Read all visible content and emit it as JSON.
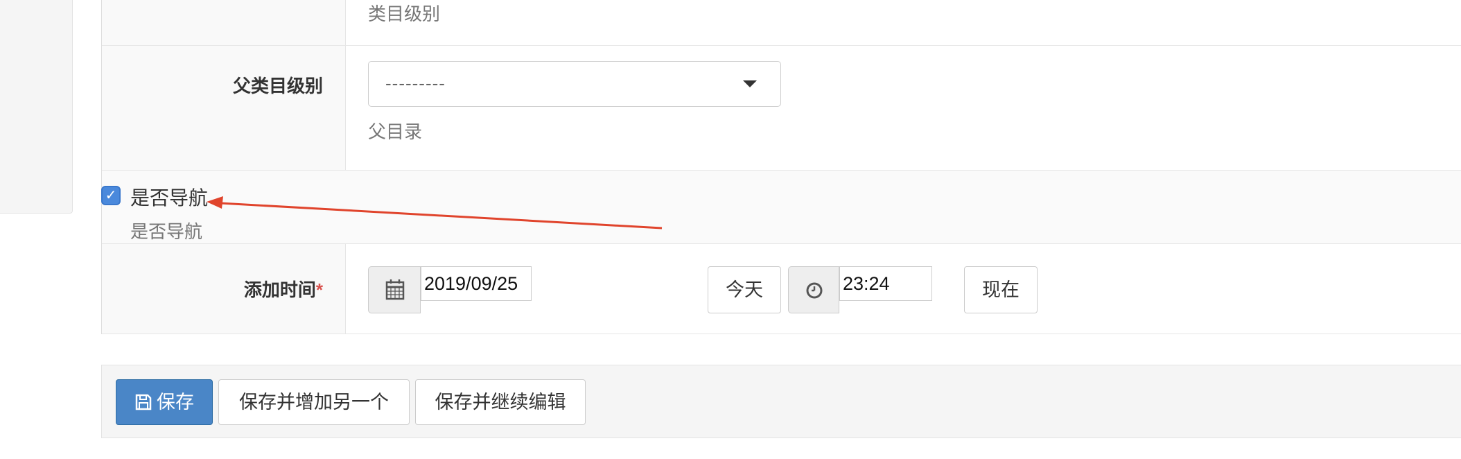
{
  "category_level": {
    "help": "类目级别"
  },
  "parent_level": {
    "label": "父类目级别",
    "select_value": "---------",
    "help": "父目录"
  },
  "is_nav": {
    "checked": true,
    "label": "是否导航",
    "help": "是否导航"
  },
  "add_time": {
    "label": "添加时间",
    "required_mark": "*",
    "date_value": "2019/09/25",
    "today_button": "今天",
    "time_value": "23:24",
    "now_button": "现在"
  },
  "footer": {
    "save_label": "保存",
    "save_add_another_label": "保存并增加另一个",
    "save_continue_label": "保存并继续编辑"
  },
  "icons": {
    "calendar": "calendar-icon",
    "clock": "clock-icon",
    "save": "floppy-icon",
    "dropdown": "caret-down-icon",
    "check": "check-icon"
  },
  "colors": {
    "primary_button": "#4a86c7",
    "checkbox": "#4a89dc",
    "annotation_arrow": "#e0442c",
    "required": "#d9534f"
  }
}
